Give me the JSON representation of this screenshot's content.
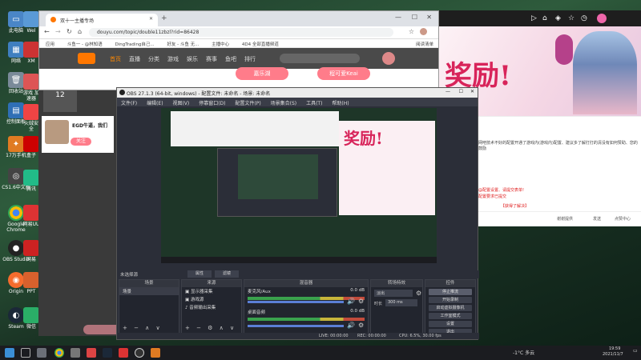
{
  "desktop": {
    "icons_col1": [
      "此电脑",
      "网络",
      "回收站",
      "控制面板",
      "17万手机",
      "CS1.6中文版",
      "Google Chrome",
      "OBS Studio",
      "Origin",
      "Steam"
    ],
    "icons_col2": [
      "Wel",
      "XM",
      "游戏 加速器",
      "火绒安全",
      "盒子",
      "腾讯",
      "网易UU",
      "网易",
      "PPT",
      "微信"
    ]
  },
  "browser": {
    "tab_title": "双十一主播专场",
    "url": "douyu.com/topic/double11zbzl?rid=86428",
    "bookmarks": [
      "应用",
      "斗鱼一 - @林知语",
      "DingTrading自己...",
      "好友 - 斗鱼 无...",
      "主播中心",
      "4D4 全部直播频道"
    ],
    "nav": [
      "首页",
      "直播",
      "分类",
      "游戏",
      "娱乐",
      "赛事",
      "鱼吧",
      "排行"
    ],
    "pink_buttons": [
      "嘉乐湖",
      "程可爱Keai"
    ],
    "reading_mode": "阅读清单"
  },
  "left_doc": {
    "room_number": "12",
    "room_label": "EGD牛逼，我们",
    "follow": "关注"
  },
  "right_page": {
    "banner_text": "奖励!",
    "chat_lines": [
      "网吧技术不好的配置开通了游戏内(游戏内)配置、建议多了解打打的清没有如何赞助、您的鼓励",
      "@配置设置、请提交表单!",
      "配置要求已提交",
      "【获得了解决】"
    ],
    "chat_footer": [
      "谢谢提供",
      "发送",
      "点赞中心"
    ]
  },
  "obs": {
    "title": "OBS 27.1.3 (64-bit, windows) - 配置文件: 未命名 - 场景: 未命名",
    "menu": [
      "文件(F)",
      "编辑(E)",
      "视图(V)",
      "停靠窗口(D)",
      "配置文件(P)",
      "场景集合(S)",
      "工具(T)",
      "帮助(H)"
    ],
    "scene_status": "未选择源",
    "props_buttons": [
      "属性",
      "滤镜"
    ],
    "docks": {
      "scenes": {
        "title": "场景",
        "items": [
          "场景"
        ]
      },
      "sources": {
        "title": "来源",
        "items": [
          "显示器采集",
          "游戏源",
          "音频输出采集"
        ]
      },
      "mixer": {
        "title": "混音器",
        "channels": [
          {
            "name": "麦克风/Aux",
            "level": "0.0 dB"
          },
          {
            "name": "桌面音频",
            "level": "0.0 dB"
          }
        ]
      },
      "transitions": {
        "title": "转场特效",
        "type": "淡出",
        "duration_label": "时长",
        "duration": "300 ms"
      },
      "controls": {
        "title": "控件",
        "buttons": [
          "停止推流",
          "开始录制",
          "启动虚拟摄像机",
          "工作室模式",
          "设置",
          "退出"
        ]
      }
    },
    "statusbar": {
      "live": "LIVE: 00:00:00",
      "rec": "REC: 00:00:00",
      "cpu": "CPU: 6.5%, 30.00 fps"
    }
  },
  "taskbar": {
    "weather": "-1°C 多云",
    "time": "19:59",
    "date": "2021/11/7"
  },
  "colors": {
    "accent_pink": "#ff7c8a",
    "obs_bg": "#2b2e38",
    "taskbar": "#1b1c20",
    "meter_green": "#3aa24d"
  }
}
